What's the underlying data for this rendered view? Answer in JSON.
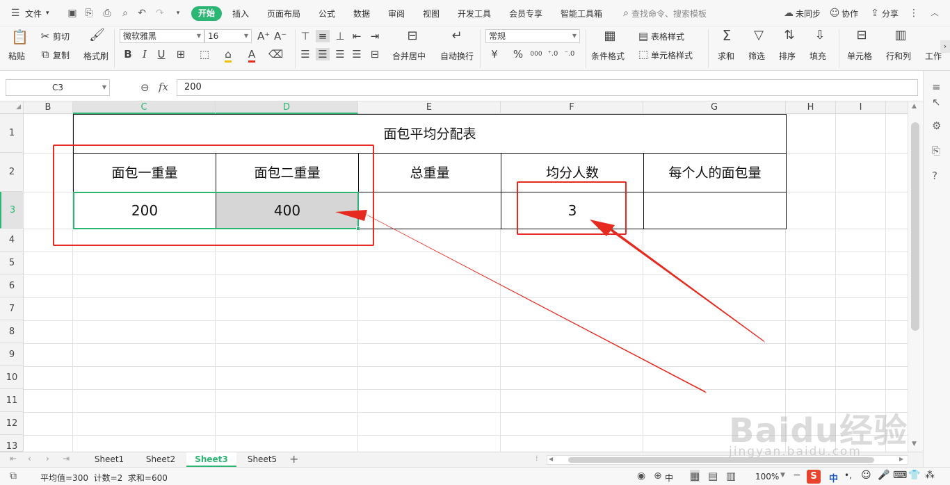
{
  "menubar": {
    "file": "文件",
    "tabs": [
      "开始",
      "插入",
      "页面布局",
      "公式",
      "数据",
      "审阅",
      "视图",
      "开发工具",
      "会员专享",
      "智能工具箱"
    ],
    "search_placeholder": "查找命令、搜索模板",
    "unsync": "未同步",
    "collab": "协作",
    "share": "分享"
  },
  "ribbon": {
    "paste": "粘贴",
    "cut": "剪切",
    "copy": "复制",
    "format_painter": "格式刷",
    "font_name": "微软雅黑",
    "font_size": "16",
    "bold": "B",
    "italic": "I",
    "underline": "U",
    "merge_center": "合并居中",
    "wrap": "自动换行",
    "number_format": "常规",
    "currency": "¥",
    "percent": "%",
    "thousands": "000",
    "cond_format": "条件格式",
    "table_style": "表格样式",
    "cell_style": "单元格样式",
    "sum": "求和",
    "filter": "筛选",
    "sort": "排序",
    "fill": "填充",
    "cell": "单元格",
    "rowcol": "行和列",
    "worksheet": "工作"
  },
  "formula_bar": {
    "name_box": "C3",
    "fx": "fx",
    "value": "200"
  },
  "columns": [
    "B",
    "C",
    "D",
    "E",
    "F",
    "G",
    "H",
    "I"
  ],
  "rows": [
    "1",
    "2",
    "3",
    "4",
    "5",
    "6",
    "7",
    "8",
    "9",
    "10",
    "11",
    "12",
    "13"
  ],
  "table": {
    "title": "面包平均分配表",
    "headers": [
      "面包一重量",
      "面包二重量",
      "总重量",
      "均分人数",
      "每个人的面包量"
    ],
    "values": [
      "200",
      "400",
      "",
      "3",
      ""
    ]
  },
  "sheets": [
    "Sheet1",
    "Sheet2",
    "Sheet3",
    "Sheet5"
  ],
  "active_sheet": "Sheet3",
  "status": {
    "summary": "平均值=300  计数=2  求和=600",
    "zoom": "100%",
    "view_label": "中",
    "ime": "中"
  },
  "colors": {
    "accent": "#2bb673",
    "annotation": "#e62a1f"
  },
  "watermark": {
    "brand": "Baidu经验",
    "url": "jingyan.baidu.com"
  }
}
